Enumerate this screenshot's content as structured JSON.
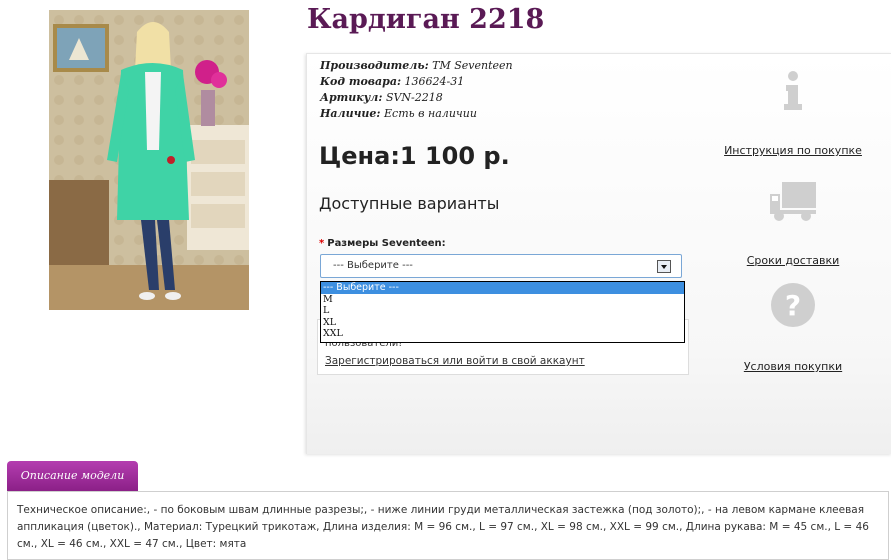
{
  "product": {
    "title": "Кардиган 2218",
    "meta": {
      "manufacturer_label": "Производитель:",
      "manufacturer_value": "TM Seventeen",
      "code_label": "Код товара:",
      "code_value": "136624-31",
      "article_label": "Артикул:",
      "article_value": "SVN-2218",
      "availability_label": "Наличие:",
      "availability_value": "Есть в наличии"
    },
    "price": "Цена:1 100 р.",
    "variants_heading": "Доступные варианты",
    "size": {
      "required_mark": "*",
      "label": "Размеры Seventeen:",
      "selected": "--- Выберите ---",
      "options": [
        "--- Выберите ---",
        "M",
        "L",
        "XL",
        "XXL"
      ]
    },
    "account_box": {
      "partial_text": "пользователи!",
      "link": "Зарегистрироваться или войти в свой аккаунт"
    }
  },
  "sidebar": {
    "items": [
      {
        "icon": "info-icon",
        "label": "Инструкция по покупке"
      },
      {
        "icon": "truck-icon",
        "label": "Сроки доставки"
      },
      {
        "icon": "question-icon",
        "label": "Условия покупки"
      }
    ]
  },
  "description": {
    "tab_label": "Описание модели",
    "text": "Техническое описание:, - по боковым швам длинные разрезы;, - ниже линии груди металлическая застежка (под золото);, - на левом кармане клеевая аппликация (цветок)., Материал: Турецкий трикотаж, Длина изделия: M = 96 см., L = 97 см., XL = 98 см., XXL = 99 см., Длина рукава: M = 45 см., L = 46 см., XL = 46 см., XXL = 47 см., Цвет: мята"
  },
  "colors": {
    "title": "#5a1a55",
    "tab": "#a12e9d",
    "select_highlight": "#3d8fe0",
    "cardigan": "#3fd3a6"
  }
}
